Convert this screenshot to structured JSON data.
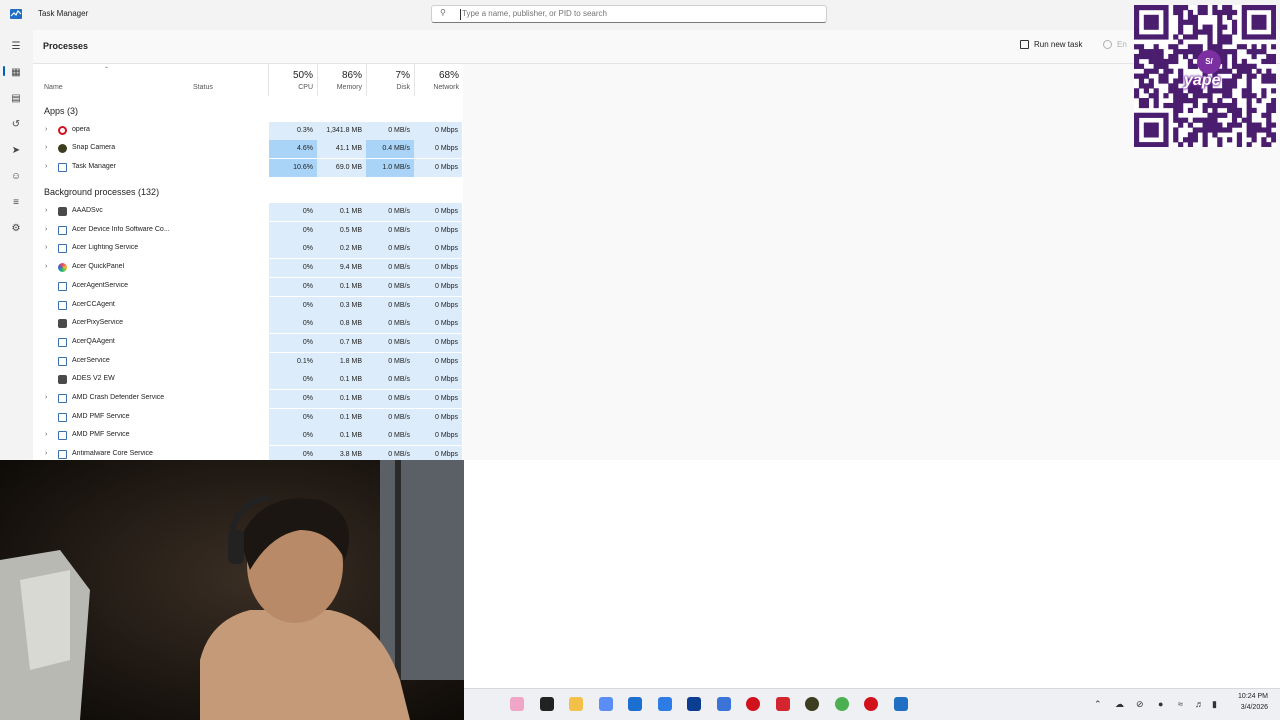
{
  "window": {
    "title": "Task Manager",
    "search_placeholder": "Type a name, publisher, or PID to search"
  },
  "toolbar": {
    "page_title": "Processes",
    "run_new_task": "Run new task",
    "end_task": "En"
  },
  "sidebar_icons": [
    "menu-icon",
    "processes-icon",
    "performance-icon",
    "app-history-icon",
    "startup-apps-icon",
    "users-icon",
    "details-icon",
    "services-icon"
  ],
  "columns": {
    "name": "Name",
    "status": "Status",
    "cpu_pct": "50%",
    "cpu": "CPU",
    "mem_pct": "86%",
    "mem": "Memory",
    "disk_pct": "7%",
    "disk": "Disk",
    "net_pct": "68%",
    "net": "Network"
  },
  "groups": {
    "apps": "Apps (3)",
    "background": "Background processes (132)"
  },
  "apps": [
    {
      "name": "opera",
      "cpu": "0.3%",
      "mem": "1,341.8 MB",
      "disk": "0 MB/s",
      "net": "0 Mbps",
      "icon": "opera-icon",
      "color": "#d1121d"
    },
    {
      "name": "Snap Camera",
      "cpu": "4.6%",
      "mem": "41.1 MB",
      "disk": "0.4 MB/s",
      "net": "0 Mbps",
      "icon": "snap-camera-icon",
      "color": "#3d3d1f"
    },
    {
      "name": "Task Manager",
      "cpu": "10.6%",
      "mem": "69.0 MB",
      "disk": "1.0 MB/s",
      "net": "0 Mbps",
      "icon": "task-manager-icon",
      "color": "#1f6fc2"
    }
  ],
  "background": [
    {
      "name": "AAADSvc",
      "cpu": "0%",
      "mem": "0.1 MB",
      "disk": "0 MB/s",
      "net": "0 Mbps",
      "expand": true,
      "icon": "service-gear-icon"
    },
    {
      "name": "Acer Device Info Software Co...",
      "cpu": "0%",
      "mem": "0.5 MB",
      "disk": "0 MB/s",
      "net": "0 Mbps",
      "expand": true,
      "icon": "app-window-icon"
    },
    {
      "name": "Acer Lighting Service",
      "cpu": "0%",
      "mem": "0.2 MB",
      "disk": "0 MB/s",
      "net": "0 Mbps",
      "expand": true,
      "icon": "app-window-icon"
    },
    {
      "name": "Acer QuickPanel",
      "cpu": "0%",
      "mem": "9.4 MB",
      "disk": "0 MB/s",
      "net": "0 Mbps",
      "expand": true,
      "icon": "quickpanel-icon"
    },
    {
      "name": "AcerAgentService",
      "cpu": "0%",
      "mem": "0.1 MB",
      "disk": "0 MB/s",
      "net": "0 Mbps",
      "expand": false,
      "icon": "app-window-icon"
    },
    {
      "name": "AcerCCAgent",
      "cpu": "0%",
      "mem": "0.3 MB",
      "disk": "0 MB/s",
      "net": "0 Mbps",
      "expand": false,
      "icon": "app-window-icon"
    },
    {
      "name": "AcerPixyService",
      "cpu": "0%",
      "mem": "0.8 MB",
      "disk": "0 MB/s",
      "net": "0 Mbps",
      "expand": false,
      "icon": "service-gear-icon"
    },
    {
      "name": "AcerQAAgent",
      "cpu": "0%",
      "mem": "0.7 MB",
      "disk": "0 MB/s",
      "net": "0 Mbps",
      "expand": false,
      "icon": "app-window-icon"
    },
    {
      "name": "AcerService",
      "cpu": "0.1%",
      "mem": "1.8 MB",
      "disk": "0 MB/s",
      "net": "0 Mbps",
      "expand": false,
      "icon": "app-window-icon"
    },
    {
      "name": "ADES V2 EW",
      "cpu": "0%",
      "mem": "0.1 MB",
      "disk": "0 MB/s",
      "net": "0 Mbps",
      "expand": false,
      "icon": "service-gear-icon"
    },
    {
      "name": "AMD Crash Defender Service",
      "cpu": "0%",
      "mem": "0.1 MB",
      "disk": "0 MB/s",
      "net": "0 Mbps",
      "expand": true,
      "icon": "app-window-icon"
    },
    {
      "name": "AMD PMF Service",
      "cpu": "0%",
      "mem": "0.1 MB",
      "disk": "0 MB/s",
      "net": "0 Mbps",
      "expand": false,
      "icon": "app-window-icon"
    },
    {
      "name": "AMD PMF Service",
      "cpu": "0%",
      "mem": "0.1 MB",
      "disk": "0 MB/s",
      "net": "0 Mbps",
      "expand": true,
      "icon": "app-window-icon"
    },
    {
      "name": "Antimalware Core Service",
      "cpu": "0%",
      "mem": "3.8 MB",
      "disk": "0 MB/s",
      "net": "0 Mbps",
      "expand": true,
      "icon": "app-window-icon"
    }
  ],
  "overlay": {
    "qr_badge": "S/",
    "qr_brand": "yape"
  },
  "taskbar": {
    "icons": [
      "widgets-icon",
      "file-icon",
      "folder-icon",
      "copilot-icon",
      "store-icon",
      "dropbox-icon",
      "powershell-icon",
      "browser-icon",
      "opera-icon",
      "wps-icon",
      "snap-camera-icon",
      "chrome-icon",
      "record-icon",
      "task-manager-icon"
    ],
    "time": "10:24 PM",
    "date": "3/4/2026"
  },
  "colors": {
    "cpu_light": "#dcecfb",
    "cpu_heat": "#a9d4f7",
    "mem_heat": "#9dcff6",
    "accent": "#005fb8"
  }
}
